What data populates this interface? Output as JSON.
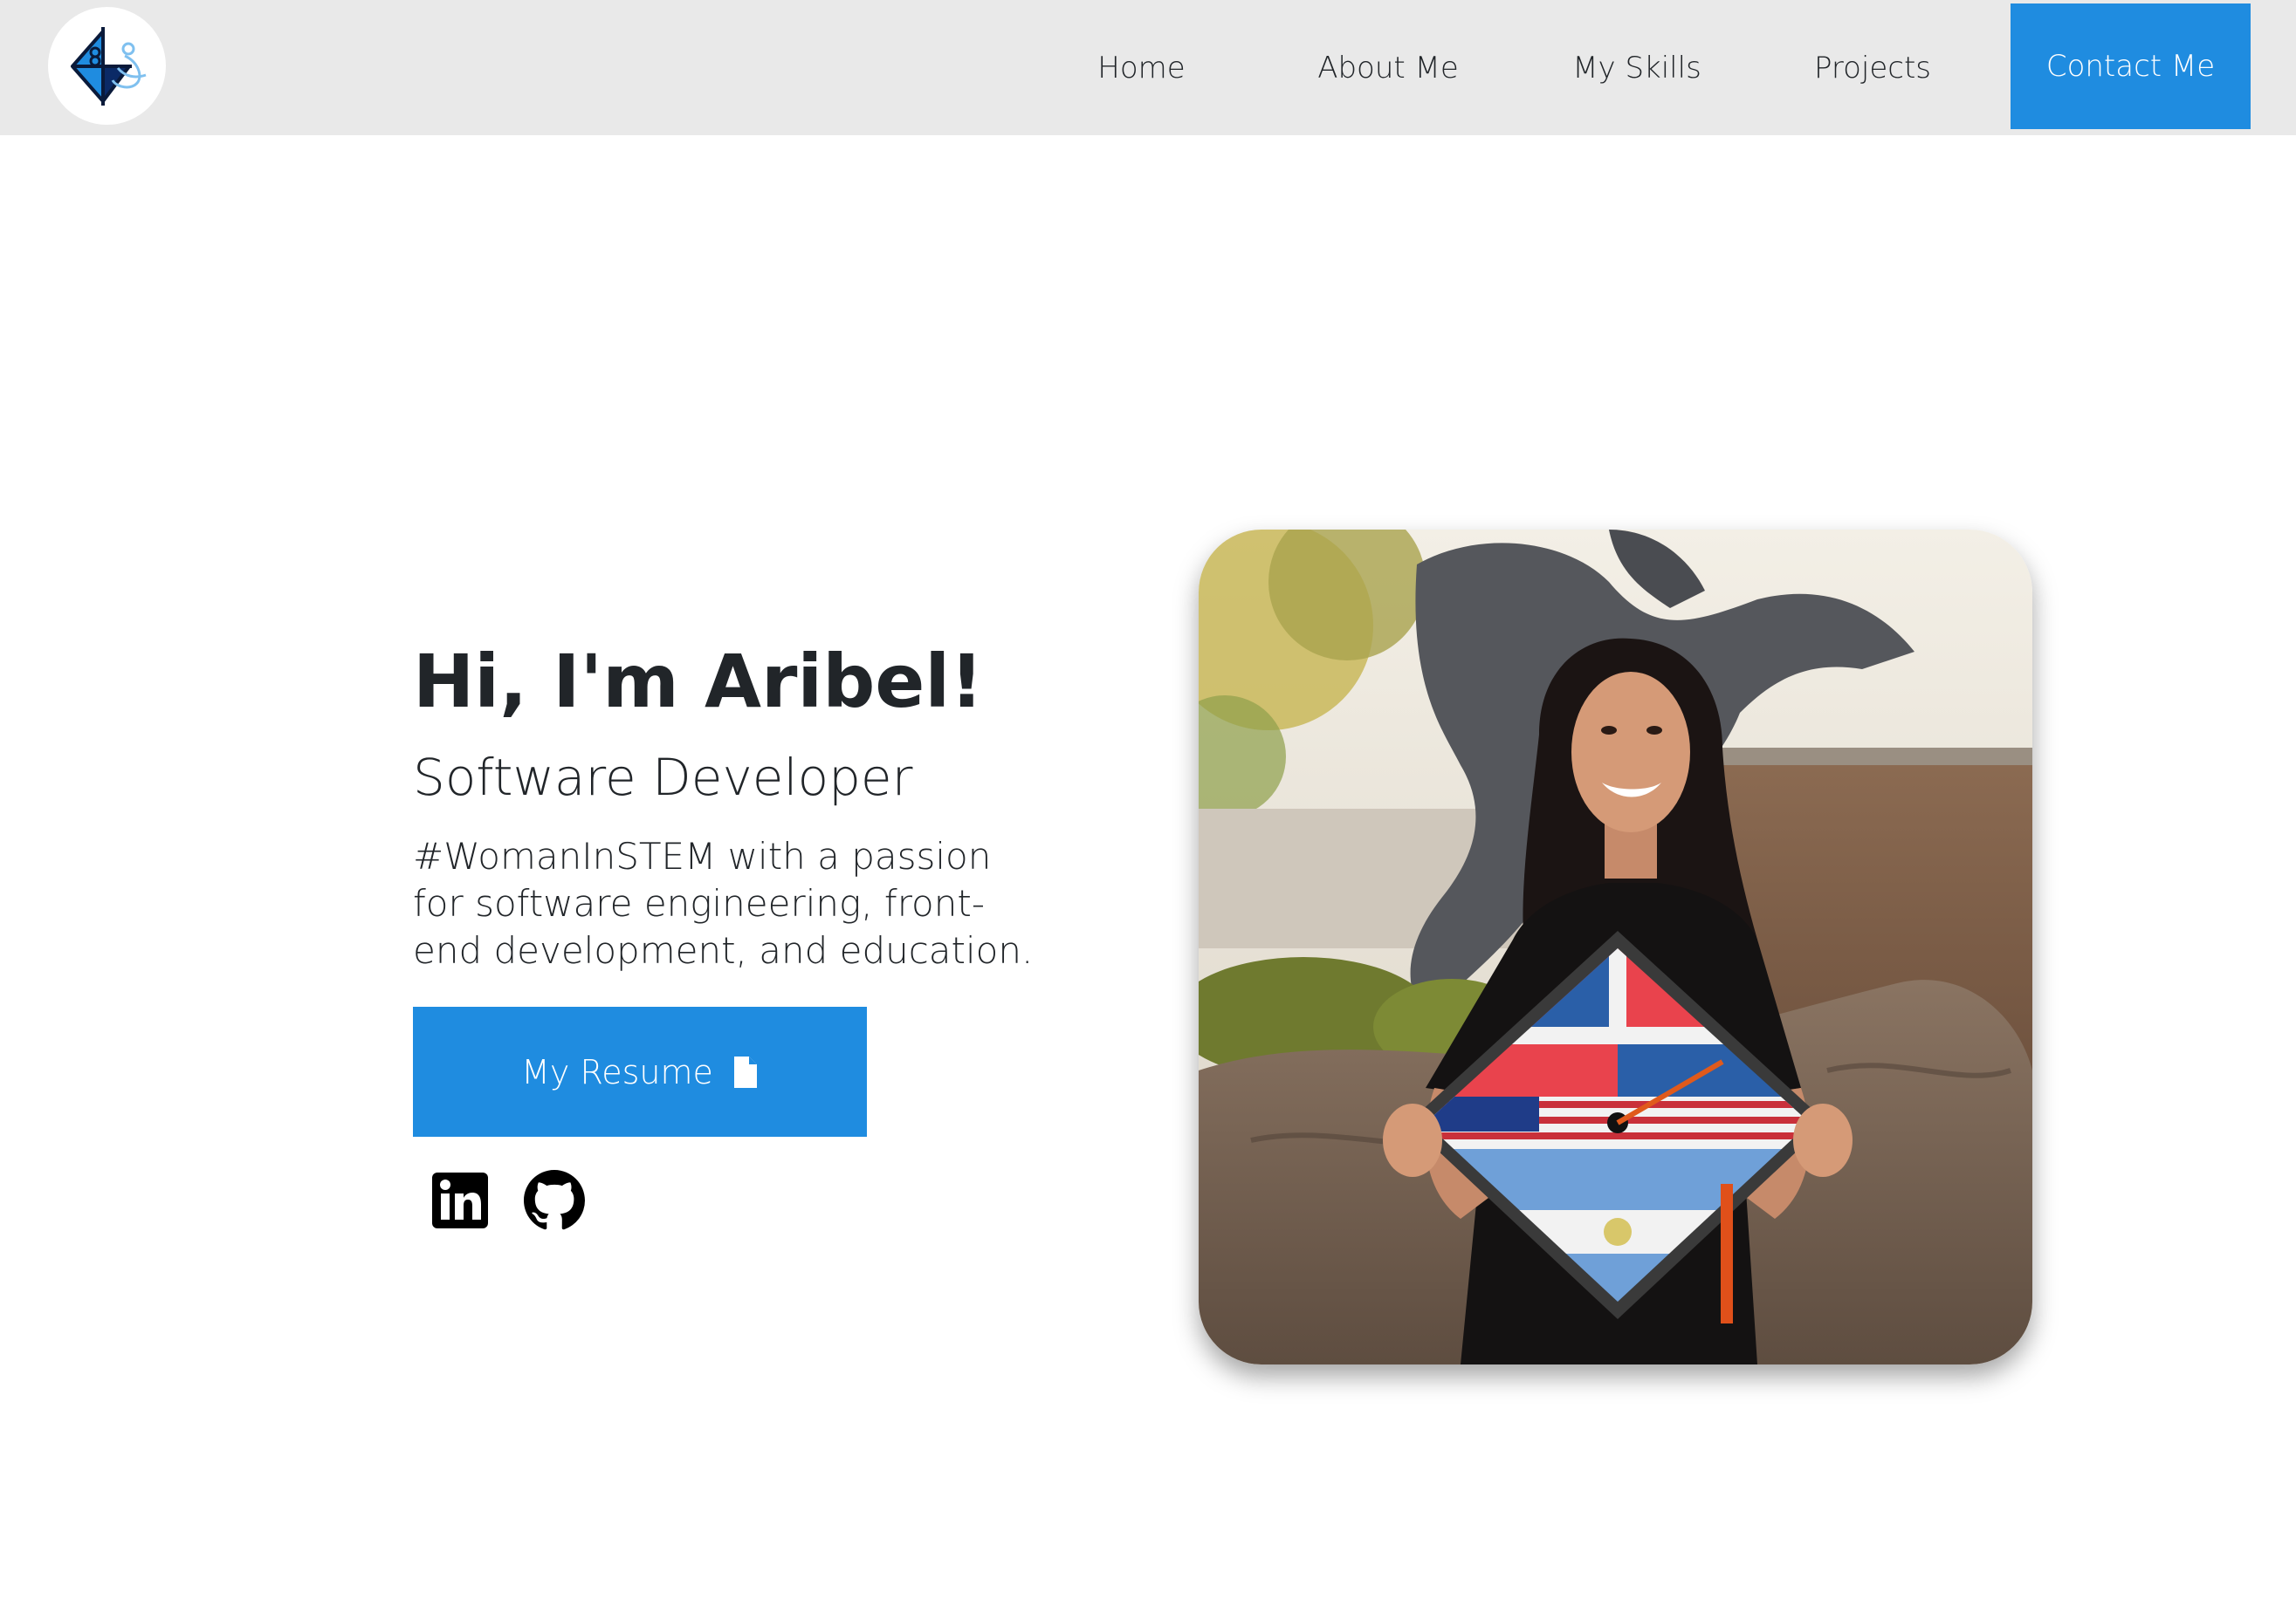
{
  "nav": {
    "logo_icon": "butterfly-logo-icon",
    "items": [
      {
        "label": "Home"
      },
      {
        "label": "About Me"
      },
      {
        "label": "My Skills"
      },
      {
        "label": "Projects"
      }
    ],
    "contact_label": "Contact Me"
  },
  "hero": {
    "title": "Hi, I'm Aribel!",
    "subtitle": "Software Developer",
    "description": "#WomanInSTEM with a passion for software engineering, front-end development, and education.",
    "resume_label": "My Resume",
    "resume_icon": "file-icon",
    "socials": [
      {
        "icon": "linkedin-icon"
      },
      {
        "icon": "github-icon"
      }
    ]
  },
  "colors": {
    "accent": "#1f8ce0",
    "navbar_bg": "#e9e9e9",
    "text": "#212529"
  }
}
